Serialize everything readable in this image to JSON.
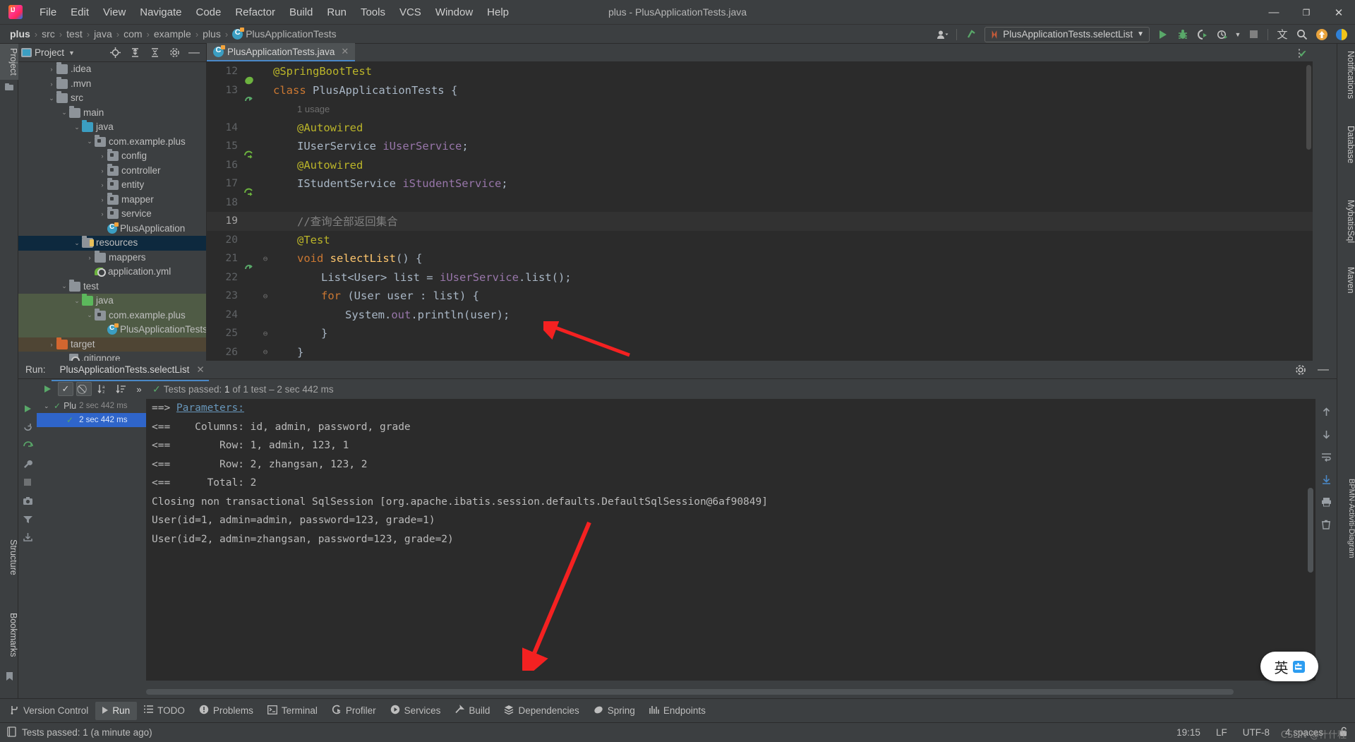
{
  "window": {
    "title": "plus - PlusApplicationTests.java",
    "logo_icon": "intellij-idea-logo",
    "controls": {
      "minimize": "—",
      "maximize": "❐",
      "close": "✕"
    }
  },
  "menu": {
    "items": [
      "File",
      "Edit",
      "View",
      "Navigate",
      "Code",
      "Refactor",
      "Build",
      "Run",
      "Tools",
      "VCS",
      "Window",
      "Help"
    ]
  },
  "navbar": {
    "breadcrumbs": [
      "plus",
      "src",
      "test",
      "java",
      "com",
      "example",
      "plus",
      "PlusApplicationTests"
    ],
    "separator": "›",
    "class_icon": "java-class-icon",
    "run_config": "PlusApplicationTests.selectList",
    "actions": {
      "account": "account-icon",
      "updates": "update-arrow-icon",
      "run": "run-icon",
      "debug": "debug-icon",
      "run_coverage": "run-with-coverage-icon",
      "profiler": "profiler-icon",
      "stop": "stop-icon",
      "translate": "translate-icon",
      "search": "search-icon",
      "notifications": "notification-icon",
      "more": "more-options-icon"
    }
  },
  "left_strip": {
    "project_label": "Project",
    "structure_label": "Structure",
    "bookmarks_label": "Bookmarks"
  },
  "right_strip": {
    "notifications_label": "Notifications",
    "database_label": "Database",
    "mybatis_label": "MybatisSql",
    "maven_label": "Maven",
    "bpmn_label": "BPMN-Activiti-Diagram"
  },
  "project_panel": {
    "title": "Project",
    "icon": "project-view-icon",
    "actions": [
      "locate-icon",
      "expand-all-icon",
      "collapse-all-icon",
      "settings-icon",
      "hide-icon"
    ],
    "tree": [
      {
        "label": ".idea",
        "indent": 1,
        "chevron": "›",
        "icon": "folder",
        "state": ""
      },
      {
        "label": ".mvn",
        "indent": 1,
        "chevron": "›",
        "icon": "folder",
        "state": ""
      },
      {
        "label": "src",
        "indent": 1,
        "chevron": "⌄",
        "icon": "folder",
        "state": ""
      },
      {
        "label": "main",
        "indent": 2,
        "chevron": "⌄",
        "icon": "folder",
        "state": ""
      },
      {
        "label": "java",
        "indent": 3,
        "chevron": "⌄",
        "icon": "folder-blue",
        "state": ""
      },
      {
        "label": "com.example.plus",
        "indent": 4,
        "chevron": "⌄",
        "icon": "folder-pkg",
        "state": ""
      },
      {
        "label": "config",
        "indent": 5,
        "chevron": "›",
        "icon": "folder-pkg",
        "state": ""
      },
      {
        "label": "controller",
        "indent": 5,
        "chevron": "›",
        "icon": "folder-pkg",
        "state": ""
      },
      {
        "label": "entity",
        "indent": 5,
        "chevron": "›",
        "icon": "folder-pkg",
        "state": ""
      },
      {
        "label": "mapper",
        "indent": 5,
        "chevron": "›",
        "icon": "folder-pkg",
        "state": ""
      },
      {
        "label": "service",
        "indent": 5,
        "chevron": "›",
        "icon": "folder-pkg",
        "state": ""
      },
      {
        "label": "PlusApplication",
        "indent": 5,
        "chevron": "",
        "icon": "spring-class",
        "state": ""
      },
      {
        "label": "resources",
        "indent": 3,
        "chevron": "⌄",
        "icon": "folder-res",
        "state": "selected"
      },
      {
        "label": "mappers",
        "indent": 4,
        "chevron": "›",
        "icon": "folder",
        "state": ""
      },
      {
        "label": "application.yml",
        "indent": 4,
        "chevron": "",
        "icon": "spring-yaml",
        "state": ""
      },
      {
        "label": "test",
        "indent": 2,
        "chevron": "⌄",
        "icon": "folder",
        "state": ""
      },
      {
        "label": "java",
        "indent": 3,
        "chevron": "⌄",
        "icon": "folder-green",
        "state": "test"
      },
      {
        "label": "com.example.plus",
        "indent": 4,
        "chevron": "⌄",
        "icon": "folder-pkg",
        "state": "test"
      },
      {
        "label": "PlusApplicationTests",
        "indent": 5,
        "chevron": "",
        "icon": "java-class",
        "state": "test"
      },
      {
        "label": "target",
        "indent": 1,
        "chevron": "›",
        "icon": "folder-orange",
        "state": "target"
      },
      {
        "label": ".gitignore",
        "indent": 2,
        "chevron": "",
        "icon": "git-file",
        "state": ""
      }
    ]
  },
  "editor": {
    "tab": {
      "label": "PlusApplicationTests.java",
      "icon": "java-class-icon",
      "close": "✕"
    },
    "inspection_status": "✔",
    "lines": [
      {
        "num": "12",
        "gutter": "spring-bean-icon",
        "fold": "",
        "indent": 0,
        "tokens": [
          {
            "t": "@SpringBootTest",
            "c": "ann"
          }
        ]
      },
      {
        "num": "13",
        "gutter": "run-test-icon",
        "fold": "",
        "indent": 0,
        "tokens": [
          {
            "t": "class ",
            "c": "kw"
          },
          {
            "t": "PlusApplicationTests ",
            "c": "typ"
          },
          {
            "t": "{",
            "c": "typ"
          }
        ]
      },
      {
        "num": "",
        "gutter": "",
        "fold": "",
        "indent": 1,
        "usage": "1 usage"
      },
      {
        "num": "14",
        "gutter": "",
        "fold": "",
        "indent": 1,
        "tokens": [
          {
            "t": "@Autowired",
            "c": "ann"
          }
        ]
      },
      {
        "num": "15",
        "gutter": "bean-arrow-icon",
        "fold": "",
        "indent": 1,
        "tokens": [
          {
            "t": "IUserService ",
            "c": "typ"
          },
          {
            "t": "iUserService",
            "c": "fld"
          },
          {
            "t": ";",
            "c": "typ"
          }
        ]
      },
      {
        "num": "16",
        "gutter": "",
        "fold": "",
        "indent": 1,
        "tokens": [
          {
            "t": "@Autowired",
            "c": "ann"
          }
        ]
      },
      {
        "num": "17",
        "gutter": "bean-arrow-icon",
        "fold": "",
        "indent": 1,
        "tokens": [
          {
            "t": "IStudentService ",
            "c": "typ"
          },
          {
            "t": "iStudentService",
            "c": "fld"
          },
          {
            "t": ";",
            "c": "typ"
          }
        ]
      },
      {
        "num": "18",
        "gutter": "",
        "fold": "",
        "indent": 1,
        "tokens": []
      },
      {
        "num": "19",
        "gutter": "",
        "fold": "",
        "indent": 1,
        "highlight": true,
        "tokens": [
          {
            "t": "//查询全部返回集合",
            "c": "cmt"
          }
        ]
      },
      {
        "num": "20",
        "gutter": "",
        "fold": "",
        "indent": 1,
        "tokens": [
          {
            "t": "@Test",
            "c": "ann"
          }
        ]
      },
      {
        "num": "21",
        "gutter": "run-test-icon",
        "fold": "⊖",
        "indent": 1,
        "tokens": [
          {
            "t": "void ",
            "c": "kw"
          },
          {
            "t": "selectList",
            "c": "mth"
          },
          {
            "t": "() {",
            "c": "typ"
          }
        ]
      },
      {
        "num": "22",
        "gutter": "",
        "fold": "",
        "indent": 2,
        "tokens": [
          {
            "t": "List<User> list = ",
            "c": "typ"
          },
          {
            "t": "iUserService",
            "c": "fld"
          },
          {
            "t": ".list();",
            "c": "typ"
          }
        ]
      },
      {
        "num": "23",
        "gutter": "",
        "fold": "⊖",
        "indent": 2,
        "tokens": [
          {
            "t": "for ",
            "c": "kw"
          },
          {
            "t": "(User user : list) {",
            "c": "typ"
          }
        ]
      },
      {
        "num": "24",
        "gutter": "",
        "fold": "",
        "indent": 3,
        "tokens": [
          {
            "t": "System.",
            "c": "typ"
          },
          {
            "t": "out",
            "c": "fld"
          },
          {
            "t": ".println(user);",
            "c": "typ"
          }
        ]
      },
      {
        "num": "25",
        "gutter": "",
        "fold": "⊖",
        "indent": 2,
        "tokens": [
          {
            "t": "}",
            "c": "typ"
          }
        ]
      },
      {
        "num": "26",
        "gutter": "",
        "fold": "⊖",
        "indent": 1,
        "tokens": [
          {
            "t": "}",
            "c": "typ"
          }
        ]
      }
    ]
  },
  "run_window": {
    "label": "Run:",
    "tab": "PlusApplicationTests.selectList",
    "tab_icon": "test-config-icon",
    "tab_close": "✕",
    "settings_icon": "settings-icon",
    "minimize_icon": "minimize-icon",
    "toolbar": {
      "rerun_icon": "rerun-icon",
      "show_passed_icon": "show-passed-tests-icon",
      "show_ignored_icon": "show-ignored-tests-icon",
      "sort_alpha_icon": "sort-alphabetically-icon",
      "sort_duration_icon": "sort-by-duration-icon",
      "more_icon": "»",
      "status_prefix": "Tests passed:",
      "status_count": "1",
      "status_suffix": "of 1 test – 2 sec 442 ms"
    },
    "side_icons": [
      "rerun-icon",
      "rerun-failed-icon",
      "toggle-icon",
      "wrench-icon",
      "stop-icon",
      "camera-icon",
      "filter-icon",
      "export-icon"
    ],
    "test_tree": [
      {
        "label": "Plu",
        "time": "2 sec 442 ms",
        "chevron": "⌄",
        "status": "passed",
        "selected": false
      },
      {
        "label": "",
        "time": "2 sec 442 ms",
        "chevron": "",
        "status": "passed",
        "selected": true
      }
    ],
    "console": [
      {
        "text": "==> Parameters:",
        "link_from": 4
      },
      {
        "text": "<==    Columns: id, admin, password, grade"
      },
      {
        "text": "<==        Row: 1, admin, 123, 1"
      },
      {
        "text": "<==        Row: 2, zhangsan, 123, 2"
      },
      {
        "text": "<==      Total: 2"
      },
      {
        "text": "Closing non transactional SqlSession [org.apache.ibatis.session.defaults.DefaultSqlSession@6af90849]"
      },
      {
        "text": "User(id=1, admin=admin, password=123, grade=1)"
      },
      {
        "text": "User(id=2, admin=zhangsan, password=123, grade=2)"
      }
    ],
    "console_side_icons": [
      "scroll-up-icon",
      "scroll-down-icon",
      "soft-wrap-icon",
      "scroll-to-end-icon",
      "print-icon",
      "clear-all-icon"
    ]
  },
  "bottom_tabs": [
    {
      "label": "Version Control",
      "icon": "branch-icon",
      "active": false
    },
    {
      "label": "Run",
      "icon": "run-icon",
      "active": true
    },
    {
      "label": "TODO",
      "icon": "todo-icon",
      "active": false
    },
    {
      "label": "Problems",
      "icon": "problems-icon",
      "active": false
    },
    {
      "label": "Terminal",
      "icon": "terminal-icon",
      "active": false
    },
    {
      "label": "Profiler",
      "icon": "profiler-icon",
      "active": false
    },
    {
      "label": "Services",
      "icon": "services-icon",
      "active": false
    },
    {
      "label": "Build",
      "icon": "build-icon",
      "active": false
    },
    {
      "label": "Dependencies",
      "icon": "dependencies-icon",
      "active": false
    },
    {
      "label": "Spring",
      "icon": "spring-icon",
      "active": false
    },
    {
      "label": "Endpoints",
      "icon": "endpoints-icon",
      "active": false
    }
  ],
  "status_bar": {
    "icon": "status-info-icon",
    "message": "Tests passed: 1 (a minute ago)",
    "time": "19:15",
    "line_separator": "LF",
    "encoding": "UTF-8",
    "indent": "4 spaces",
    "lock_icon": "unlocked-icon",
    "watermark": "CSDN @什什程"
  },
  "ime_overlay": {
    "mode": "英",
    "badge_icon": "ime-keyboard-icon"
  },
  "annotations": {
    "arrow1": "red-arrow-pointing-to-list-call",
    "arrow2": "red-arrow-pointing-to-user-output",
    "color": "#f42121"
  }
}
